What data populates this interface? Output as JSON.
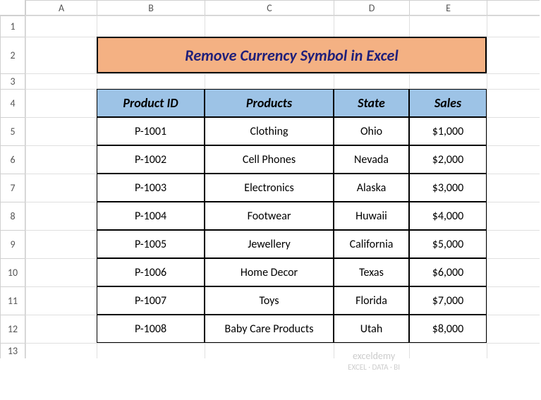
{
  "columns": [
    "A",
    "B",
    "C",
    "D",
    "E"
  ],
  "rows": [
    "1",
    "2",
    "3",
    "4",
    "5",
    "6",
    "7",
    "8",
    "9",
    "10",
    "11",
    "12",
    "13"
  ],
  "title": "Remove Currency Symbol in Excel",
  "headers": {
    "product_id": "Product ID",
    "products": "Products",
    "state": "State",
    "sales": "Sales"
  },
  "data": [
    {
      "id": "P-1001",
      "product": "Clothing",
      "state": "Ohio",
      "sales": "$1,000"
    },
    {
      "id": "P-1002",
      "product": "Cell Phones",
      "state": "Nevada",
      "sales": "$2,000"
    },
    {
      "id": "P-1003",
      "product": "Electronics",
      "state": "Alaska",
      "sales": "$3,000"
    },
    {
      "id": "P-1004",
      "product": "Footwear",
      "state": "Huwaii",
      "sales": "$4,000"
    },
    {
      "id": "P-1005",
      "product": "Jewellery",
      "state": "California",
      "sales": "$5,000"
    },
    {
      "id": "P-1006",
      "product": "Home Decor",
      "state": "Texas",
      "sales": "$6,000"
    },
    {
      "id": "P-1007",
      "product": "Toys",
      "state": "Florida",
      "sales": "$7,000"
    },
    {
      "id": "P-1008",
      "product": "Baby Care Products",
      "state": "Utah",
      "sales": "$8,000"
    }
  ],
  "watermark": {
    "brand": "exceldemy",
    "tagline": "EXCEL · DATA · BI"
  }
}
